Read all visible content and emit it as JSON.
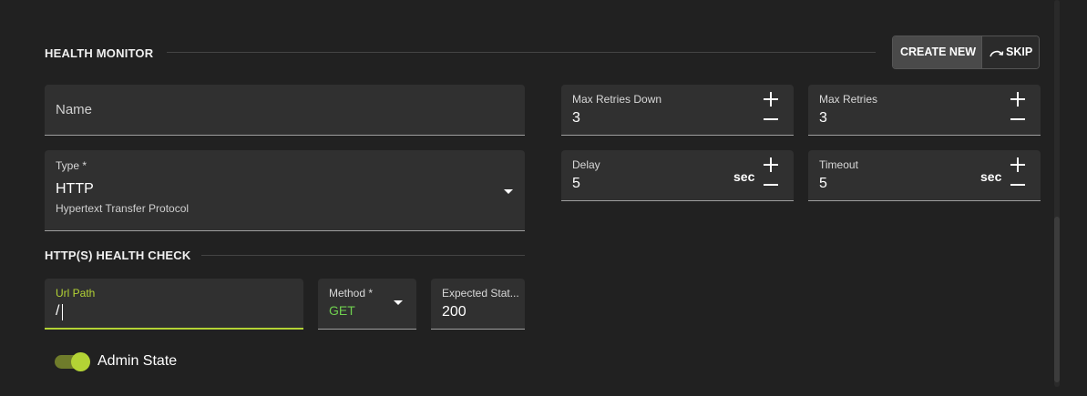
{
  "health_monitor": {
    "title": "HEALTH MONITOR",
    "create_new_label": "CREATE NEW",
    "skip_label": "SKIP",
    "name_placeholder": "Name",
    "type": {
      "label": "Type *",
      "value": "HTTP",
      "description": "Hypertext Transfer Protocol"
    },
    "max_retries_down": {
      "label": "Max Retries Down",
      "value": "3"
    },
    "max_retries": {
      "label": "Max Retries",
      "value": "3"
    },
    "delay": {
      "label": "Delay",
      "value": "5",
      "unit": "sec"
    },
    "timeout": {
      "label": "Timeout",
      "value": "5",
      "unit": "sec"
    }
  },
  "http_check": {
    "title": "HTTP(S) HEALTH CHECK",
    "url_path": {
      "label": "Url Path",
      "value": "/"
    },
    "method": {
      "label": "Method *",
      "value": "GET"
    },
    "expected_status": {
      "label": "Expected Stat...",
      "value": "200"
    }
  },
  "admin_state": {
    "label": "Admin State",
    "enabled": true
  },
  "colors": {
    "accent": "#b3d335",
    "method_green": "#6fcf4f",
    "background": "#212121",
    "field_bg": "#303030"
  }
}
